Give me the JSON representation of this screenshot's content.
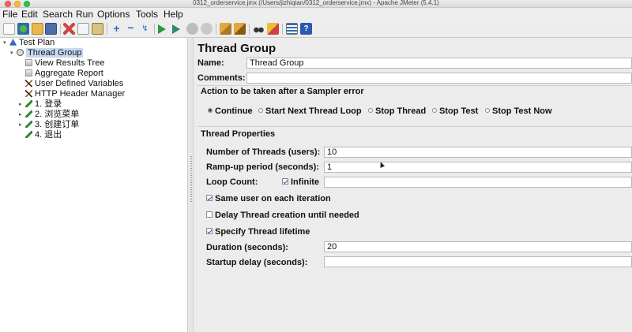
{
  "window": {
    "title": "0312_orderservice.jmx (/Users/jizhiqian/0312_orderservice.jmx) - Apache JMeter (5.4.1)"
  },
  "menubar": {
    "items": [
      "File",
      "Edit",
      "Search",
      "Run",
      "Options",
      "Tools",
      "Help"
    ]
  },
  "toolbar": {
    "icons": [
      "new-icon",
      "templates-icon",
      "open-icon",
      "save-icon",
      "cut-icon",
      "copy-icon",
      "paste-icon",
      "expand-icon",
      "collapse-icon",
      "toggle-icon",
      "start-icon",
      "start-no-pause-icon",
      "stop-icon",
      "shutdown-icon",
      "clear-icon",
      "clear-all-icon",
      "search-icon",
      "reset-search-icon",
      "function-helper-icon",
      "help-icon"
    ]
  },
  "tree": {
    "items": [
      {
        "label": "Test Plan",
        "icon": "test-plan-icon",
        "depth": 0,
        "arrow": "▾",
        "selected": false
      },
      {
        "label": "Thread Group",
        "icon": "thread-group-icon",
        "depth": 1,
        "arrow": "▾",
        "selected": true
      },
      {
        "label": "View Results Tree",
        "icon": "listener-icon",
        "depth": 2,
        "arrow": "",
        "selected": false
      },
      {
        "label": "Aggregate Report",
        "icon": "listener-icon",
        "depth": 2,
        "arrow": "",
        "selected": false
      },
      {
        "label": "User Defined Variables",
        "icon": "config-icon",
        "depth": 2,
        "arrow": "",
        "selected": false
      },
      {
        "label": "HTTP Header Manager",
        "icon": "config-icon",
        "depth": 2,
        "arrow": "",
        "selected": false
      },
      {
        "label": "1. 登录",
        "icon": "controller-icon",
        "depth": 2,
        "arrow": "▸",
        "selected": false
      },
      {
        "label": "2. 浏览菜单",
        "icon": "controller-icon",
        "depth": 2,
        "arrow": "▸",
        "selected": false
      },
      {
        "label": "3. 创建订单",
        "icon": "controller-icon",
        "depth": 2,
        "arrow": "▸",
        "selected": false
      },
      {
        "label": "4. 退出",
        "icon": "controller-icon",
        "depth": 2,
        "arrow": "",
        "selected": false
      }
    ]
  },
  "panel": {
    "title": "Thread Group",
    "name_label": "Name:",
    "name_value": "Thread Group",
    "comments_label": "Comments:",
    "comments_value": "",
    "sampler_error": {
      "title": "Action to be taken after a Sampler error",
      "options": [
        {
          "label": "Continue",
          "selected": true
        },
        {
          "label": "Start Next Thread Loop",
          "selected": false
        },
        {
          "label": "Stop Thread",
          "selected": false
        },
        {
          "label": "Stop Test",
          "selected": false
        },
        {
          "label": "Stop Test Now",
          "selected": false
        }
      ]
    },
    "thread_properties": {
      "title": "Thread Properties",
      "threads_label": "Number of Threads (users):",
      "threads_value": "10",
      "rampup_label": "Ramp-up period (seconds):",
      "rampup_value": "1",
      "loop_label": "Loop Count:",
      "infinite_label": "Infinite",
      "infinite_checked": true,
      "loop_value": "",
      "same_user_label": "Same user on each iteration",
      "same_user_checked": true,
      "delay_label": "Delay Thread creation until needed",
      "delay_checked": false,
      "lifetime_label": "Specify Thread lifetime",
      "lifetime_checked": true,
      "duration_label": "Duration (seconds):",
      "duration_value": "20",
      "startup_label": "Startup delay (seconds):",
      "startup_value": ""
    }
  }
}
